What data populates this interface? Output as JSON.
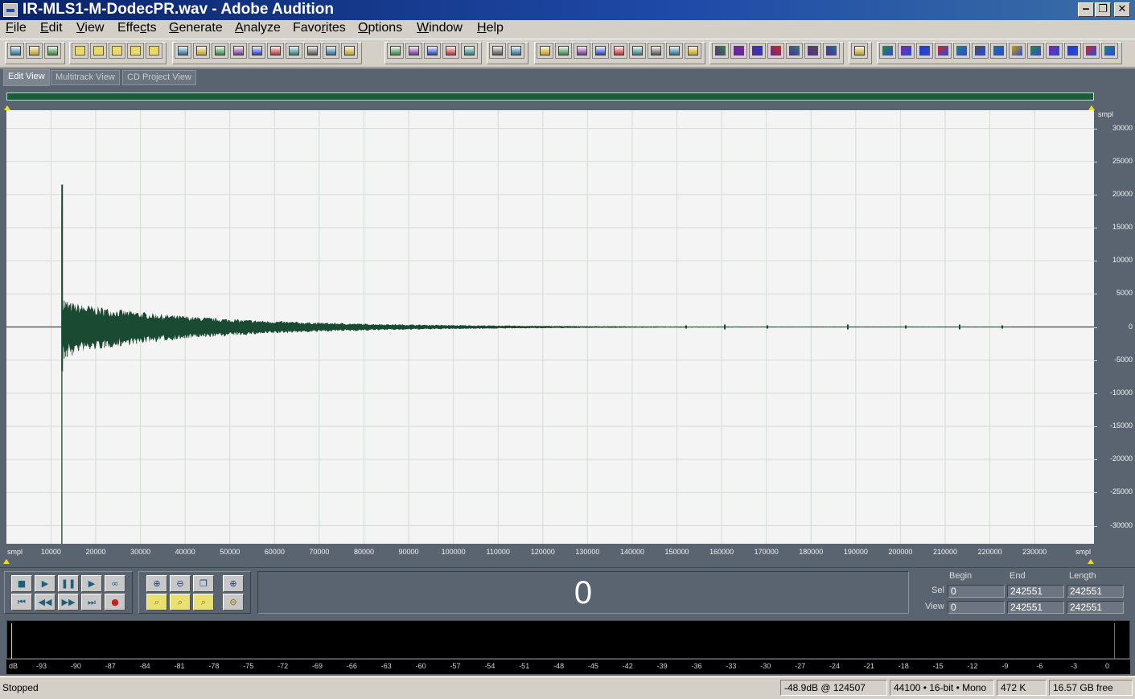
{
  "window": {
    "title": "IR-MLS1-M-DodecPR.wav - Adobe Audition",
    "minimize_glyph": "‒",
    "restore_glyph": "❐",
    "close_glyph": "✕"
  },
  "menu": {
    "items": [
      {
        "label": "File",
        "accel": "F"
      },
      {
        "label": "Edit",
        "accel": "E"
      },
      {
        "label": "View",
        "accel": "V"
      },
      {
        "label": "Effects",
        "accel": "c"
      },
      {
        "label": "Generate",
        "accel": "G"
      },
      {
        "label": "Analyze",
        "accel": "A"
      },
      {
        "label": "Favorites",
        "accel": "r"
      },
      {
        "label": "Options",
        "accel": "O"
      },
      {
        "label": "Window",
        "accel": "W"
      },
      {
        "label": "Help",
        "accel": "H"
      }
    ]
  },
  "toolbar": {
    "icons": [
      "waveform-icon",
      "multitrack-icon",
      "cd-icon",
      "new-file-icon",
      "open-folder-icon",
      "save-icon",
      "save-as-icon",
      "save-all-icon",
      "undo-icon",
      "redo-icon",
      "repeat-icon",
      "copy-new-icon",
      "copy-icon",
      "cut-icon",
      "paste-icon",
      "paste-new-icon",
      "mix-paste-icon",
      "trim-icon",
      "envelope-icon",
      "spectral-icon",
      "view-a-icon",
      "view-b-icon",
      "view-c-icon",
      "time-select-icon",
      "marquee-icon",
      "cue-list-icon",
      "play-list-icon",
      "info-icon",
      "play-icon",
      "zoom-icon",
      "time-display-icon",
      "frequency-icon",
      "level-meter-icon",
      "horiz-icon",
      "effect-1-icon",
      "effect-2-icon",
      "effect-3-icon",
      "effect-4-icon",
      "effect-5-icon",
      "effect-6-icon",
      "effect-7-icon",
      "analysis-icon",
      "aurora-ap-icon",
      "aurora-a-icon",
      "aurora-b-icon",
      "aurora-c-icon",
      "aurora-d-icon",
      "aurora-e-icon",
      "aurora-f-icon",
      "aurora-g-icon",
      "aurora-h-icon",
      "aurora-i-icon",
      "itu-p56-icon",
      "sti-icon",
      "aurora-last-icon"
    ],
    "accent_colors": [
      "#2a6e9a",
      "#7a2a9a",
      "#2a8a3a",
      "#c8a020",
      "#1e3cc8"
    ]
  },
  "tabs": [
    {
      "label": "Edit View",
      "active": true
    },
    {
      "label": "Multitrack View",
      "active": false
    },
    {
      "label": "CD Project View",
      "active": false
    }
  ],
  "waveform": {
    "y_unit": "smpl",
    "x_unit": "smpl",
    "y_ticks": [
      "30000",
      "25000",
      "20000",
      "15000",
      "10000",
      "5000",
      "0",
      "-5000",
      "-10000",
      "-15000",
      "-20000",
      "-25000",
      "-30000"
    ],
    "x_ticks": [
      "10000",
      "20000",
      "30000",
      "40000",
      "50000",
      "60000",
      "70000",
      "80000",
      "90000",
      "100000",
      "110000",
      "120000",
      "130000",
      "140000",
      "150000",
      "160000",
      "170000",
      "180000",
      "190000",
      "200000",
      "210000",
      "220000",
      "230000"
    ],
    "color": "#1a4a32",
    "background": "#f4f4f4"
  },
  "transport": {
    "time_display": "0",
    "buttons": [
      {
        "name": "stop-button",
        "glyph": "■"
      },
      {
        "name": "play-button",
        "glyph": "▶"
      },
      {
        "name": "pause-button",
        "glyph": "❚❚"
      },
      {
        "name": "play-to-end-button",
        "glyph": "▶"
      },
      {
        "name": "loop-button",
        "glyph": "∞"
      },
      {
        "name": "go-to-start-button",
        "glyph": "⏮"
      },
      {
        "name": "rewind-button",
        "glyph": "◀◀"
      },
      {
        "name": "fast-forward-button",
        "glyph": "▶▶"
      },
      {
        "name": "go-to-end-button",
        "glyph": "⏭"
      },
      {
        "name": "record-button",
        "glyph": "●"
      }
    ],
    "zoom_buttons": [
      {
        "name": "zoom-in-horizontal-button",
        "glyph": "⊕"
      },
      {
        "name": "zoom-out-horizontal-button",
        "glyph": "⊖"
      },
      {
        "name": "zoom-full-button",
        "glyph": "❐"
      },
      {
        "name": "zoom-in-vertical-button",
        "glyph": "⊕"
      },
      {
        "name": "zoom-to-left-button",
        "glyph": "⌕"
      },
      {
        "name": "zoom-selection-button",
        "glyph": "⌕"
      },
      {
        "name": "zoom-to-right-button",
        "glyph": "⌕"
      },
      {
        "name": "zoom-out-vertical-button",
        "glyph": "⊖"
      }
    ]
  },
  "selection": {
    "begin_label": "Begin",
    "end_label": "End",
    "length_label": "Length",
    "sel_label": "Sel",
    "view_label": "View",
    "sel_begin": "0",
    "sel_end": "242551",
    "sel_length": "242551",
    "view_begin": "0",
    "view_end": "242551",
    "view_length": "242551"
  },
  "meter": {
    "labels": [
      "dB",
      "-93",
      "-90",
      "-87",
      "-84",
      "-81",
      "-78",
      "-75",
      "-72",
      "-69",
      "-66",
      "-63",
      "-60",
      "-57",
      "-54",
      "-51",
      "-48",
      "-45",
      "-42",
      "-39",
      "-36",
      "-33",
      "-30",
      "-27",
      "-24",
      "-21",
      "-18",
      "-15",
      "-12",
      "-9",
      "-6",
      "-3",
      "0"
    ]
  },
  "status": {
    "state": "Stopped",
    "peak": "-48.9dB @ 124507",
    "format": "44100 • 16-bit • Mono",
    "size": "472 K",
    "free": "16.57 GB free"
  }
}
